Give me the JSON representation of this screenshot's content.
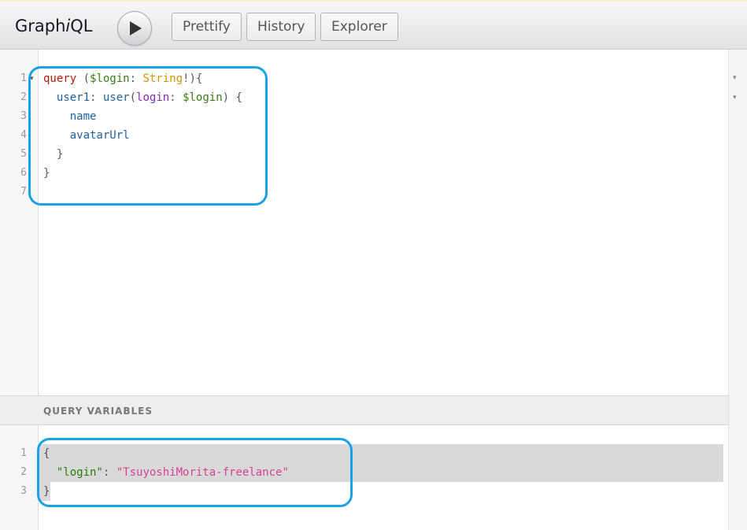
{
  "app": {
    "title_prefix": "Graph",
    "title_italic": "i",
    "title_suffix": "QL"
  },
  "toolbar": {
    "run_label": "Run query",
    "prettify_label": "Prettify",
    "history_label": "History",
    "explorer_label": "Explorer"
  },
  "query_editor": {
    "line_numbers": [
      "1",
      "2",
      "3",
      "4",
      "5",
      "6",
      "7"
    ],
    "lines": [
      [
        {
          "t": "query",
          "c": "kw"
        },
        {
          "t": " (",
          "c": "punc"
        },
        {
          "t": "$login",
          "c": "var"
        },
        {
          "t": ": ",
          "c": "punc"
        },
        {
          "t": "String",
          "c": "typ"
        },
        {
          "t": "!){",
          "c": "punc"
        }
      ],
      [
        {
          "t": "  ",
          "c": "punc"
        },
        {
          "t": "user1",
          "c": "fld"
        },
        {
          "t": ": ",
          "c": "punc"
        },
        {
          "t": "user",
          "c": "prop"
        },
        {
          "t": "(",
          "c": "punc"
        },
        {
          "t": "login",
          "c": "argn"
        },
        {
          "t": ": ",
          "c": "punc"
        },
        {
          "t": "$login",
          "c": "var"
        },
        {
          "t": ") {",
          "c": "punc"
        }
      ],
      [
        {
          "t": "    ",
          "c": "punc"
        },
        {
          "t": "name",
          "c": "fld"
        }
      ],
      [
        {
          "t": "    ",
          "c": "punc"
        },
        {
          "t": "avatarUrl",
          "c": "fld"
        }
      ],
      [
        {
          "t": "  }",
          "c": "punc"
        }
      ],
      [
        {
          "t": "}",
          "c": "punc"
        }
      ],
      []
    ]
  },
  "variables_panel": {
    "header": "QUERY VARIABLES",
    "line_numbers": [
      "1",
      "2",
      "3"
    ],
    "lines": [
      [
        {
          "t": "{",
          "c": "punc"
        }
      ],
      [
        {
          "t": "  ",
          "c": "punc"
        },
        {
          "t": "\"login\"",
          "c": "jkey"
        },
        {
          "t": ": ",
          "c": "punc"
        },
        {
          "t": "\"TsuyoshiMorita-freelance\"",
          "c": "jstr"
        }
      ],
      [
        {
          "t": "}",
          "c": "punc"
        }
      ]
    ]
  },
  "colors": {
    "highlight_box": "#1da1e6",
    "selection": "#d9d9d9"
  }
}
